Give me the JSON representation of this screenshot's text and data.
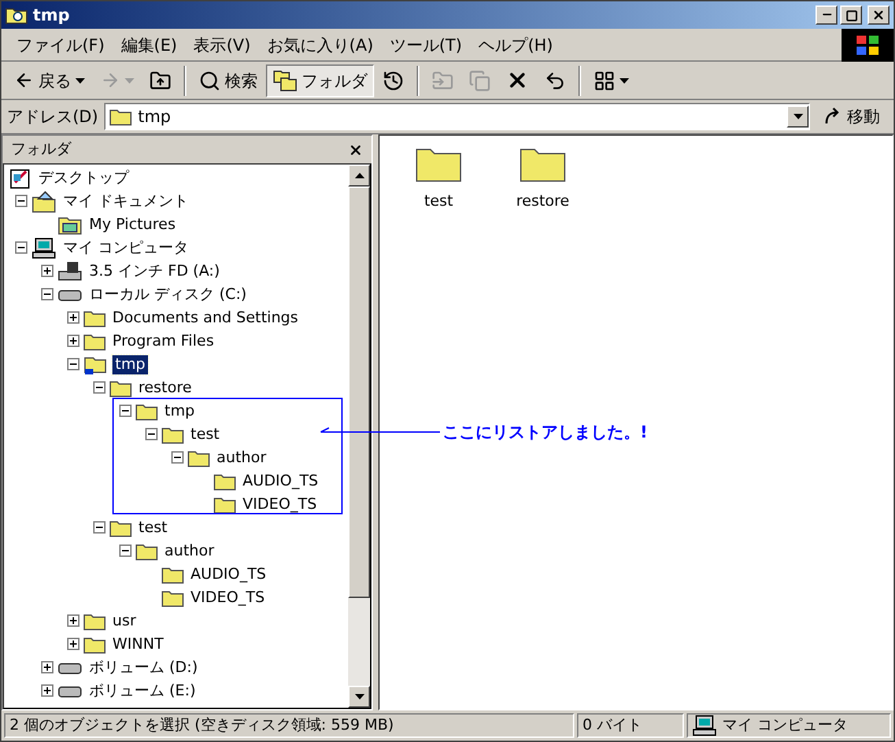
{
  "window": {
    "title": "tmp"
  },
  "menu": [
    {
      "label": "ファイル(F)"
    },
    {
      "label": "編集(E)"
    },
    {
      "label": "表示(V)"
    },
    {
      "label": "お気に入り(A)"
    },
    {
      "label": "ツール(T)"
    },
    {
      "label": "ヘルプ(H)"
    }
  ],
  "toolbar": [
    {
      "kind": "back",
      "label": "戻る",
      "disabled": false,
      "pressed": false
    },
    {
      "kind": "forward",
      "disabled": true,
      "pressed": false
    },
    {
      "kind": "up",
      "disabled": false,
      "pressed": false
    },
    {
      "kind": "separator"
    },
    {
      "kind": "search",
      "label": "検索",
      "disabled": false,
      "pressed": false
    },
    {
      "kind": "folders",
      "label": "フォルダ",
      "disabled": false,
      "pressed": true
    },
    {
      "kind": "history",
      "disabled": false,
      "pressed": false
    },
    {
      "kind": "separator"
    },
    {
      "kind": "move",
      "disabled": true,
      "pressed": false
    },
    {
      "kind": "copy",
      "disabled": true,
      "pressed": false
    },
    {
      "kind": "delete",
      "disabled": false,
      "pressed": false
    },
    {
      "kind": "undo",
      "disabled": false,
      "pressed": false
    },
    {
      "kind": "separator"
    },
    {
      "kind": "views",
      "disabled": false,
      "pressed": false
    }
  ],
  "address": {
    "label": "アドレス(D)",
    "value": "tmp",
    "go": "移動"
  },
  "folder_pane": {
    "title": "フォルダ"
  },
  "tree": [
    {
      "label": "デスクトップ",
      "kind": "desktop",
      "selected": false,
      "children": [
        {
          "label": "マイ ドキュメント",
          "kind": "documents",
          "expanded": true,
          "selected": false,
          "children": [
            {
              "label": "My Pictures",
              "kind": "pictures",
              "selected": false
            }
          ]
        },
        {
          "label": "マイ コンピュータ",
          "kind": "computer",
          "expanded": true,
          "selected": false,
          "children": [
            {
              "label": "3.5 インチ FD (A:)",
              "kind": "floppy",
              "expanded": false,
              "selected": false
            },
            {
              "label": "ローカル ディスク (C:)",
              "kind": "drive",
              "expanded": true,
              "selected": false,
              "children": [
                {
                  "label": "Documents and Settings",
                  "kind": "folder",
                  "expanded": false,
                  "selected": false
                },
                {
                  "label": "Program Files",
                  "kind": "folder",
                  "expanded": false,
                  "selected": false
                },
                {
                  "label": "tmp",
                  "kind": "shared",
                  "expanded": true,
                  "selected": true,
                  "children": [
                    {
                      "label": "restore",
                      "kind": "folder",
                      "expanded": true,
                      "selected": false,
                      "children": [
                        {
                          "label": "tmp",
                          "kind": "folder",
                          "expanded": true,
                          "selected": false,
                          "children": [
                            {
                              "label": "test",
                              "kind": "folder",
                              "expanded": true,
                              "selected": false,
                              "children": [
                                {
                                  "label": "author",
                                  "kind": "folder",
                                  "expanded": true,
                                  "selected": false,
                                  "children": [
                                    {
                                      "label": "AUDIO_TS",
                                      "kind": "folder",
                                      "selected": false
                                    },
                                    {
                                      "label": "VIDEO_TS",
                                      "kind": "folder",
                                      "selected": false
                                    }
                                  ]
                                }
                              ]
                            }
                          ]
                        }
                      ]
                    },
                    {
                      "label": "test",
                      "kind": "folder",
                      "expanded": true,
                      "selected": false,
                      "children": [
                        {
                          "label": "author",
                          "kind": "folder",
                          "expanded": true,
                          "selected": false,
                          "children": [
                            {
                              "label": "AUDIO_TS",
                              "kind": "folder",
                              "selected": false
                            },
                            {
                              "label": "VIDEO_TS",
                              "kind": "folder",
                              "selected": false
                            }
                          ]
                        }
                      ]
                    }
                  ]
                },
                {
                  "label": "usr",
                  "kind": "folder",
                  "expanded": false,
                  "selected": false
                },
                {
                  "label": "WINNT",
                  "kind": "folder",
                  "expanded": false,
                  "selected": false
                }
              ]
            },
            {
              "label": "ボリューム (D:)",
              "kind": "drive",
              "expanded": false,
              "selected": false
            },
            {
              "label": "ボリューム (E:)",
              "kind": "drive",
              "expanded": false,
              "selected": false
            }
          ]
        }
      ]
    }
  ],
  "files": [
    {
      "name": "test"
    },
    {
      "name": "restore"
    }
  ],
  "annotation": {
    "text": "ここにリストアしました。!"
  },
  "status_bar": {
    "message": "2 個のオブジェクトを選択 (空きディスク領域: 559 MB)",
    "size": "0 バイト",
    "zone": "マイ コンピュータ"
  }
}
